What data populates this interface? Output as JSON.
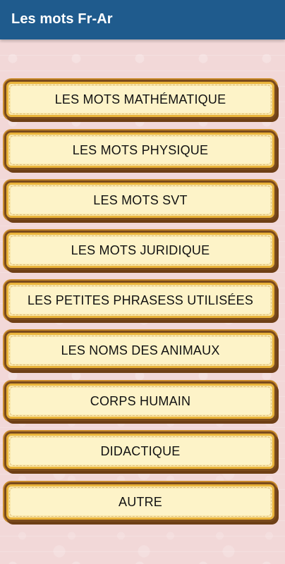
{
  "app": {
    "title": "Les mots Fr-Ar"
  },
  "menu": {
    "items": [
      {
        "label": "LES MOTS MATHÉMATIQUE"
      },
      {
        "label": "LES MOTS PHYSIQUE"
      },
      {
        "label": "LES MOTS SVT"
      },
      {
        "label": "LES MOTS JURIDIQUE"
      },
      {
        "label": "LES PETITES PHRASESS UTILISÉES"
      },
      {
        "label": "LES NOMS DES ANIMAUX"
      },
      {
        "label": "CORPS HUMAIN"
      },
      {
        "label": "DIDACTIQUE"
      },
      {
        "label": "AUTRE"
      }
    ]
  },
  "colors": {
    "app_bar": "#1f5b8d",
    "background": "#f2d8d8",
    "button_fill": "#fdf3c8",
    "button_border": "#7a4a1c"
  }
}
